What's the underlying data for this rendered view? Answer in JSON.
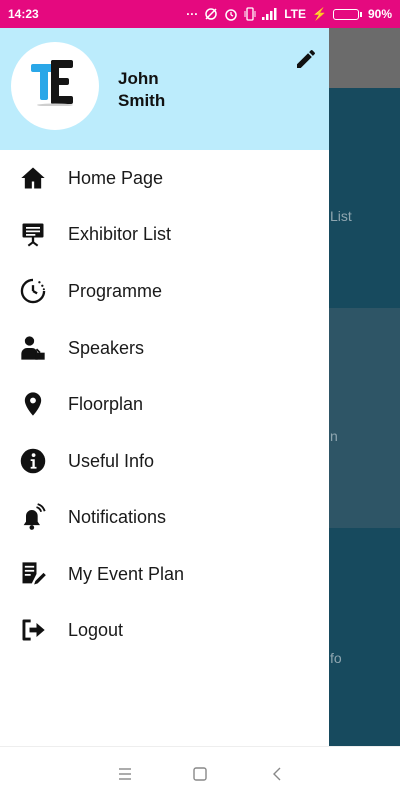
{
  "status_bar": {
    "time": "14:23",
    "network": "LTE",
    "battery": "90%",
    "battery_level": 0.9,
    "colors": {
      "background": "#e5097f"
    }
  },
  "background_content": {
    "labels": [
      "List",
      "n",
      "fo"
    ]
  },
  "drawer": {
    "header": {
      "user_name": "John\nSmith",
      "logo_text": "TE",
      "colors": {
        "background": "#bcecfc"
      }
    },
    "items": [
      {
        "label": "Home Page",
        "icon": "home-icon"
      },
      {
        "label": "Exhibitor List",
        "icon": "presentation-board-icon"
      },
      {
        "label": "Programme",
        "icon": "clock-schedule-icon"
      },
      {
        "label": "Speakers",
        "icon": "speaker-icon"
      },
      {
        "label": "Floorplan",
        "icon": "map-pin-icon"
      },
      {
        "label": "Useful Info",
        "icon": "info-icon"
      },
      {
        "label": "Notifications",
        "icon": "bell-icon"
      },
      {
        "label": "My Event Plan",
        "icon": "document-edit-icon"
      },
      {
        "label": "Logout",
        "icon": "logout-icon"
      }
    ]
  },
  "nav_bar": {
    "buttons": [
      "menu-icon",
      "home-square-icon",
      "back-icon"
    ]
  }
}
